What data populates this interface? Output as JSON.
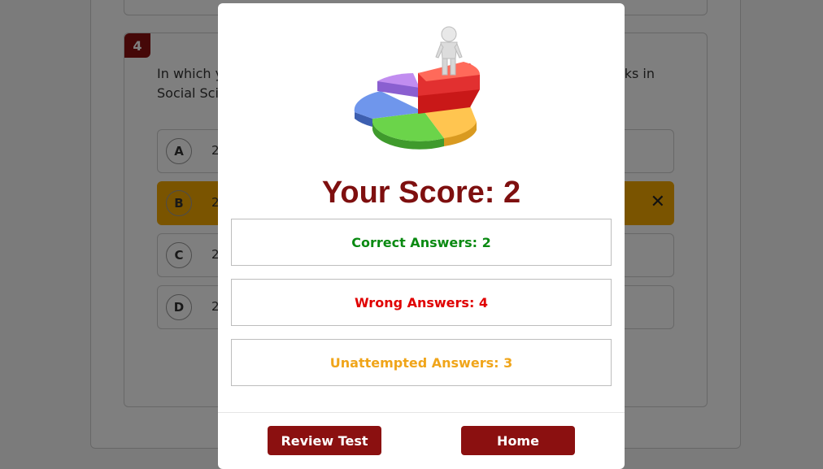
{
  "background": {
    "question_number": "4",
    "question_text_left_line1": "In which y",
    "question_text_left_line2": "Social Sci",
    "question_text_right": "ks in",
    "options": [
      {
        "letter": "A",
        "text": "2"
      },
      {
        "letter": "B",
        "text": "2"
      },
      {
        "letter": "C",
        "text": "2"
      },
      {
        "letter": "D",
        "text": "2"
      }
    ],
    "wrong_mark": "✕"
  },
  "modal": {
    "illustration": "pie-chart-figure-icon",
    "score_label": "Your Score: 2",
    "correct_label": "Correct Answers: 2",
    "wrong_label": "Wrong Answers: 4",
    "unattempted_label": "Unattempted Answers: 3",
    "review_button": "Review Test",
    "home_button": "Home"
  },
  "colors": {
    "brand": "#8b1010",
    "score_title": "#7e0f0f",
    "correct": "#0a8a12",
    "wrong": "#e00000",
    "unattempted": "#f0a51a",
    "selected_option": "#f5a800"
  }
}
